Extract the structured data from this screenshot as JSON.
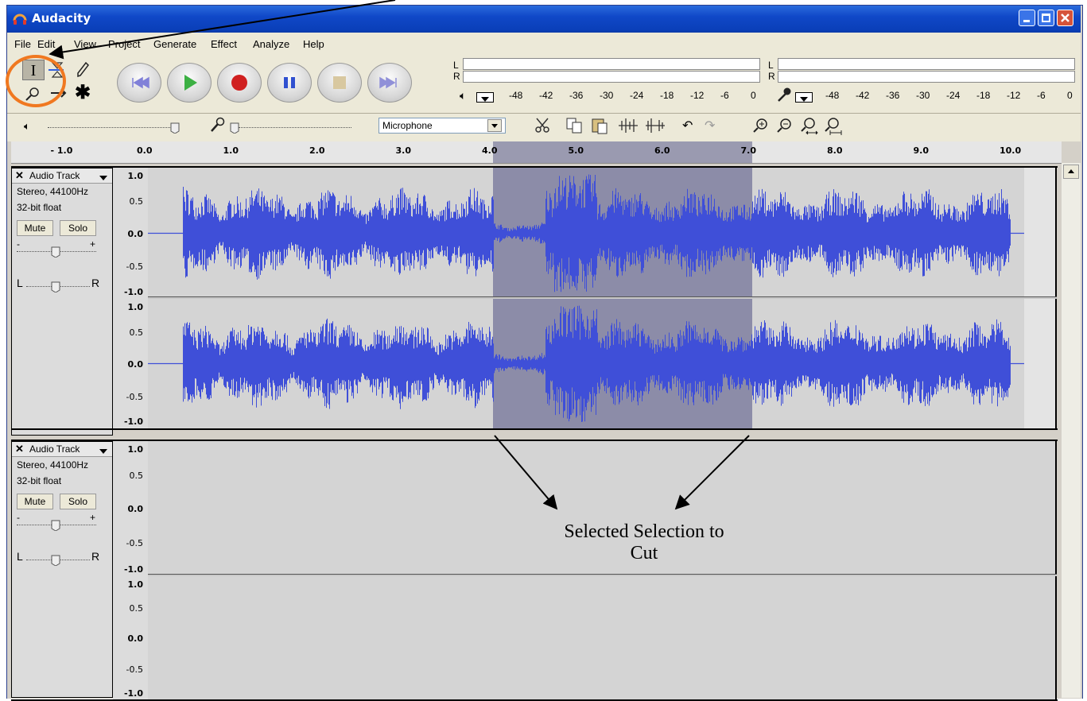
{
  "window": {
    "title": "Audacity"
  },
  "menu": [
    "File",
    "Edit",
    "View",
    "Project",
    "Generate",
    "Effect",
    "Analyze",
    "Help"
  ],
  "meter_scale": [
    "-48",
    "-42",
    "-36",
    "-30",
    "-24",
    "-18",
    "-12",
    "-6",
    "0"
  ],
  "meter_scale_in": [
    "-48",
    "-42",
    "-36",
    "-30",
    "-24",
    "-18",
    "-12",
    "-6",
    "0"
  ],
  "meter_channels": {
    "left": "L",
    "right": "R"
  },
  "mixer": {
    "input_source": "Microphone"
  },
  "ruler": [
    "- 1.0",
    "0.0",
    "1.0",
    "2.0",
    "3.0",
    "4.0",
    "5.0",
    "6.0",
    "7.0",
    "8.0",
    "9.0",
    "10.0"
  ],
  "selection": {
    "start_seconds": 4.0,
    "end_seconds": 7.0
  },
  "tracks": [
    {
      "name": "Audio Track",
      "format": "Stereo, 44100Hz",
      "depth": "32-bit float",
      "mute": "Mute",
      "solo": "Solo",
      "pan_left": "L",
      "pan_right": "R",
      "gain_minus": "-",
      "gain_plus": "+"
    },
    {
      "name": "Audio Track",
      "format": "Stereo, 44100Hz",
      "depth": "32-bit float",
      "mute": "Mute",
      "solo": "Solo",
      "pan_left": "L",
      "pan_right": "R",
      "gain_minus": "-",
      "gain_plus": "+"
    }
  ],
  "vscale": [
    "1.0",
    "0.5",
    "0.0",
    "-0.5",
    "-1.0"
  ],
  "annotation": {
    "line1": "Selected Selection to",
    "line2": "Cut"
  },
  "colors": {
    "title_bar": "#0a3fb8",
    "waveform": "#3f4fd8",
    "selection": "#8c8ca8",
    "highlight_circle": "#f07820"
  }
}
